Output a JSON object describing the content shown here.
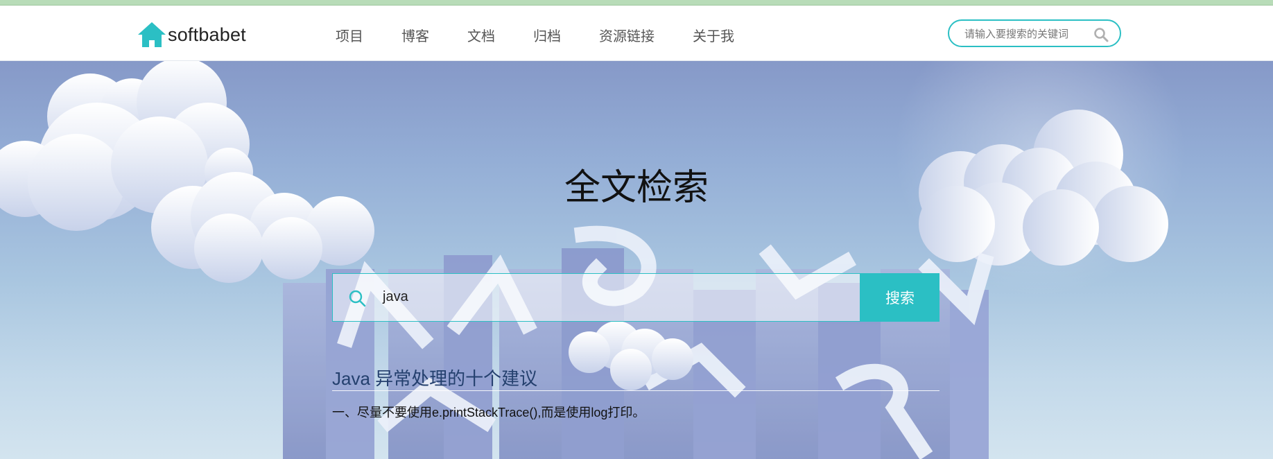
{
  "header": {
    "logo_text": "softbabet",
    "nav": [
      "项目",
      "博客",
      "文档",
      "归档",
      "资源链接",
      "关于我"
    ],
    "search_placeholder": "请输入要搜索的关键词"
  },
  "hero": {
    "title": "全文检索",
    "search_value": "java",
    "search_button": "搜索"
  },
  "results": [
    {
      "title": "Java 异常处理的十个建议",
      "snippet": "一、尽量不要使用e.printStackTrace(),而是使用log打印。"
    }
  ],
  "colors": {
    "accent": "#2bbfc4",
    "result_title": "#24406e",
    "hero_top": "#8699c8",
    "hero_bottom": "#d3e4ef"
  },
  "icons": [
    "home-icon",
    "search-icon"
  ]
}
